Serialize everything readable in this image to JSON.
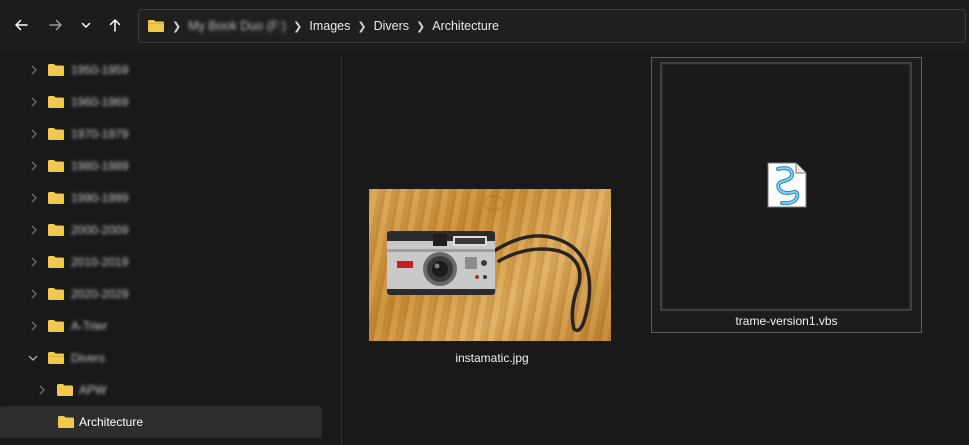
{
  "toolbar": {
    "back_icon": "arrow-left-icon",
    "forward_icon": "arrow-right-icon",
    "recent_icon": "chevron-down-icon",
    "up_icon": "arrow-up-icon"
  },
  "address": {
    "drive": "My Book Duo (F:)",
    "crumbs": [
      "Images",
      "Divers",
      "Architecture"
    ]
  },
  "sidebar": {
    "items": [
      {
        "label": "1950-1959",
        "expanded": false,
        "blurred": true
      },
      {
        "label": "1960-1969",
        "expanded": false,
        "blurred": true
      },
      {
        "label": "1970-1979",
        "expanded": false,
        "blurred": true
      },
      {
        "label": "1980-1989",
        "expanded": false,
        "blurred": true
      },
      {
        "label": "1990-1999",
        "expanded": false,
        "blurred": true
      },
      {
        "label": "2000-2009",
        "expanded": false,
        "blurred": true
      },
      {
        "label": "2010-2019",
        "expanded": false,
        "blurred": true
      },
      {
        "label": "2020-2029",
        "expanded": false,
        "blurred": true
      },
      {
        "label": "A-Trier",
        "expanded": false,
        "blurred": true
      },
      {
        "label": "Divers",
        "expanded": true,
        "blurred": true
      },
      {
        "label": "APW",
        "expanded": false,
        "blurred": true,
        "child": true
      },
      {
        "label": "Architecture",
        "expanded": false,
        "blurred": false,
        "child": true,
        "selected": true
      }
    ]
  },
  "files": [
    {
      "name": "instamatic.jpg",
      "kind": "image-thumbnail"
    },
    {
      "name": "trame-version1.vbs",
      "kind": "vbs-script-icon",
      "selected": true
    }
  ],
  "colors": {
    "background": "#191919",
    "folder": "#f2c94c",
    "selection": "#2d2d2d"
  }
}
